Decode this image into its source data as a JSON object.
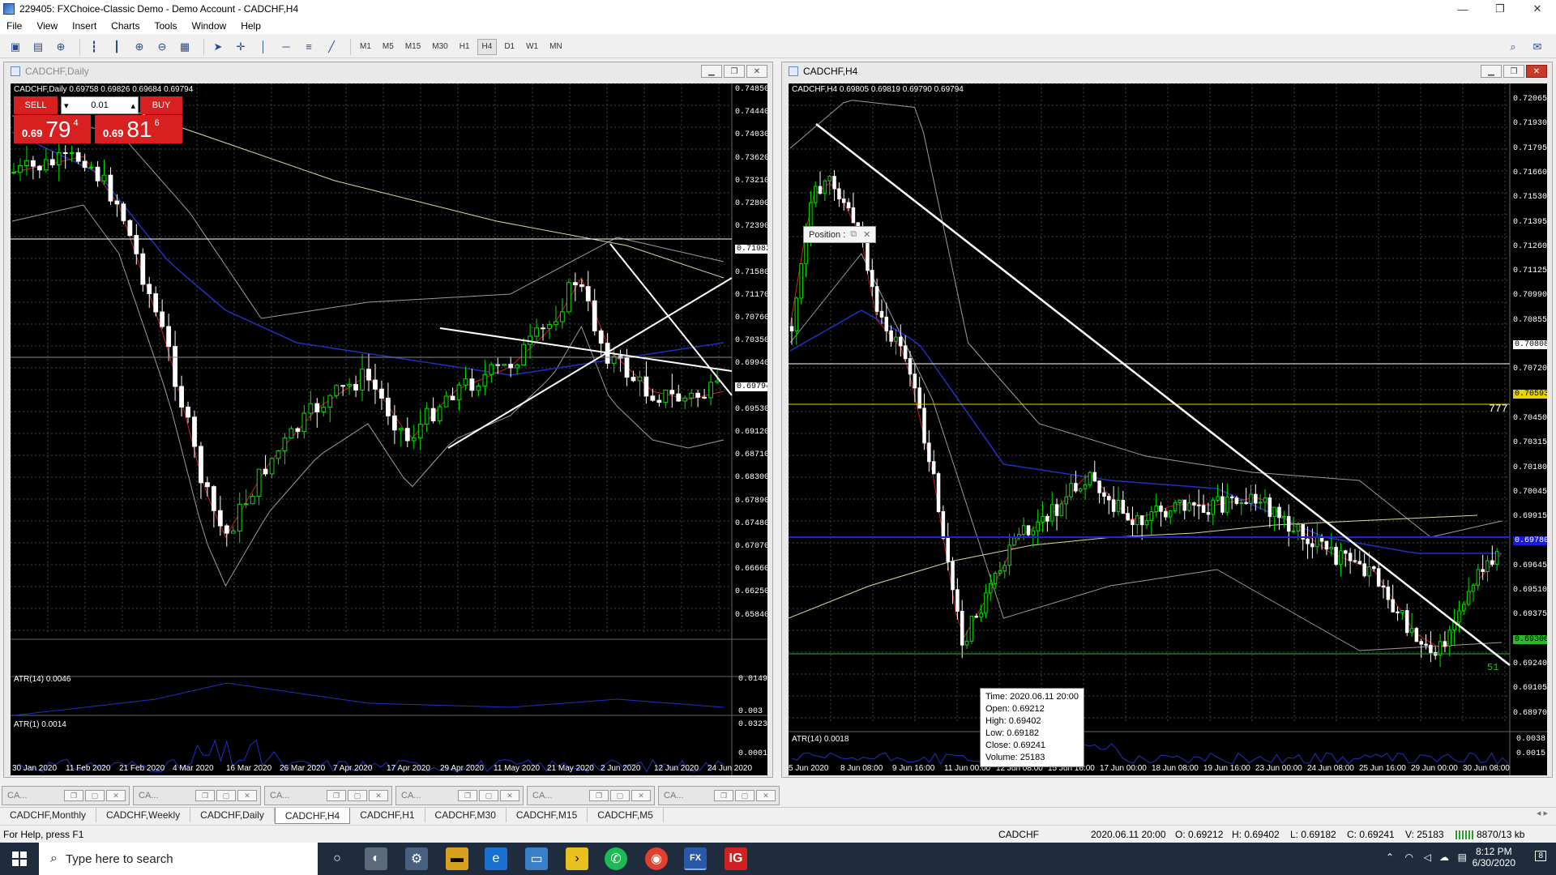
{
  "window": {
    "title": "229405: FXChoice-Classic Demo - Demo Account - CADCHF,H4",
    "min": "—",
    "max": "❐",
    "close": "✕"
  },
  "menu": [
    "File",
    "View",
    "Insert",
    "Charts",
    "Tools",
    "Window",
    "Help"
  ],
  "timeframes": [
    "M1",
    "M5",
    "M15",
    "M30",
    "H1",
    "H4",
    "D1",
    "W1",
    "MN"
  ],
  "active_timeframe": "H4",
  "left_window": {
    "title": "CADCHF,Daily",
    "header": "CADCHF,Daily  0.69758 0.69826 0.69684 0.69794",
    "trade": {
      "sell_label": "SELL",
      "buy_label": "BUY",
      "lot": "0.01",
      "sell_small": "0.69",
      "sell_big": "79",
      "sell_sup": "4",
      "buy_small": "0.69",
      "buy_big": "81",
      "buy_sup": "6"
    },
    "price_scale": [
      "0.74850",
      "0.74440",
      "0.74030",
      "0.73620",
      "0.73210",
      "0.72800",
      "0.72390",
      "0.71982",
      "0.71580",
      "0.71170",
      "0.70760",
      "0.70350",
      "0.69940",
      "0.69794",
      "0.69530",
      "0.69120",
      "0.68710",
      "0.68300",
      "0.67890",
      "0.67480",
      "0.67070",
      "0.66660",
      "0.66250",
      "0.65840"
    ],
    "hline_label": "0.71982",
    "bid_label": "0.69794",
    "atr14_label": "ATR(14) 0.0046",
    "atr14_scale": [
      "0.0149",
      "0.003"
    ],
    "atr1_label": "ATR(1) 0.0014",
    "atr1_scale": [
      "0.0323",
      "0.0001"
    ],
    "time_axis": [
      "30 Jan 2020",
      "11 Feb 2020",
      "21 Feb 2020",
      "4 Mar 2020",
      "16 Mar 2020",
      "26 Mar 2020",
      "7 Apr 2020",
      "17 Apr 2020",
      "29 Apr 2020",
      "11 May 2020",
      "21 May 2020",
      "2 Jun 2020",
      "12 Jun 2020",
      "24 Jun 2020"
    ]
  },
  "right_window": {
    "title": "CADCHF,H4",
    "header": "CADCHF,H4  0.69805 0.69819 0.69790 0.69794",
    "position_popup": "Position :",
    "price_scale": [
      "0.72065",
      "0.71930",
      "0.71795",
      "0.71660",
      "0.71530",
      "0.71395",
      "0.71260",
      "0.71125",
      "0.70990",
      "0.70855",
      "0.70808",
      "0.70720",
      "0.70593",
      "0.70450",
      "0.70315",
      "0.70180",
      "0.70045",
      "0.69915",
      "0.69780",
      "0.69645",
      "0.69510",
      "0.69375",
      "0.69300",
      "0.69240",
      "0.69105",
      "0.68970"
    ],
    "hline_white": "0.70808",
    "hline_yellow": "0.70593",
    "hline_green": "0.69300",
    "hline_blue": "0.69794",
    "marker_777": "777",
    "marker_51": "51",
    "atr14_label": "ATR(14) 0.0018",
    "atr14_scale": [
      "0.0038",
      "0.0015"
    ],
    "tooltip": [
      "Time: 2020.06.11 20:00",
      "Open: 0.69212",
      "High: 0.69402",
      "Low: 0.69182",
      "Close: 0.69241",
      "Volume: 25183"
    ],
    "time_axis": [
      "5 Jun 2020",
      "8 Jun 08:00",
      "9 Jun 16:00",
      "11 Jun 00:00",
      "12 Jun 08:00",
      "15 Jun 16:00",
      "17 Jun 00:00",
      "18 Jun 08:00",
      "19 Jun 16:00",
      "23 Jun 00:00",
      "24 Jun 08:00",
      "25 Jun 16:00",
      "29 Jun 00:00",
      "30 Jun 08:00"
    ]
  },
  "minimized": [
    "CA...",
    "CA...",
    "CA...",
    "CA...",
    "CA...",
    "CA..."
  ],
  "tabs": [
    "CADCHF,Monthly",
    "CADCHF,Weekly",
    "CADCHF,Daily",
    "CADCHF,H4",
    "CADCHF,H1",
    "CADCHF,M30",
    "CADCHF,M15",
    "CADCHF,M5"
  ],
  "active_tab": "CADCHF,H4",
  "status": {
    "help": "For Help, press F1",
    "symbol": "CADCHF",
    "time": "2020.06.11 20:00",
    "open": "O: 0.69212",
    "high": "H: 0.69402",
    "low": "L: 0.69182",
    "close": "C: 0.69241",
    "volume": "V: 25183",
    "traffic": "8870/13 kb"
  },
  "taskbar": {
    "search_placeholder": "Type here to search",
    "time": "8:12 PM",
    "date": "6/30/2020",
    "notif_count": "8"
  },
  "colors": {
    "bull": "#00e000",
    "bear": "#ffffff",
    "chart_bg": "#000000",
    "grid": "#3a4a3a",
    "red_ma": "#d02020",
    "blue_ma": "#2030c0",
    "bands": "#9a9a9a",
    "yellow_ma": "#d8d8a0"
  }
}
